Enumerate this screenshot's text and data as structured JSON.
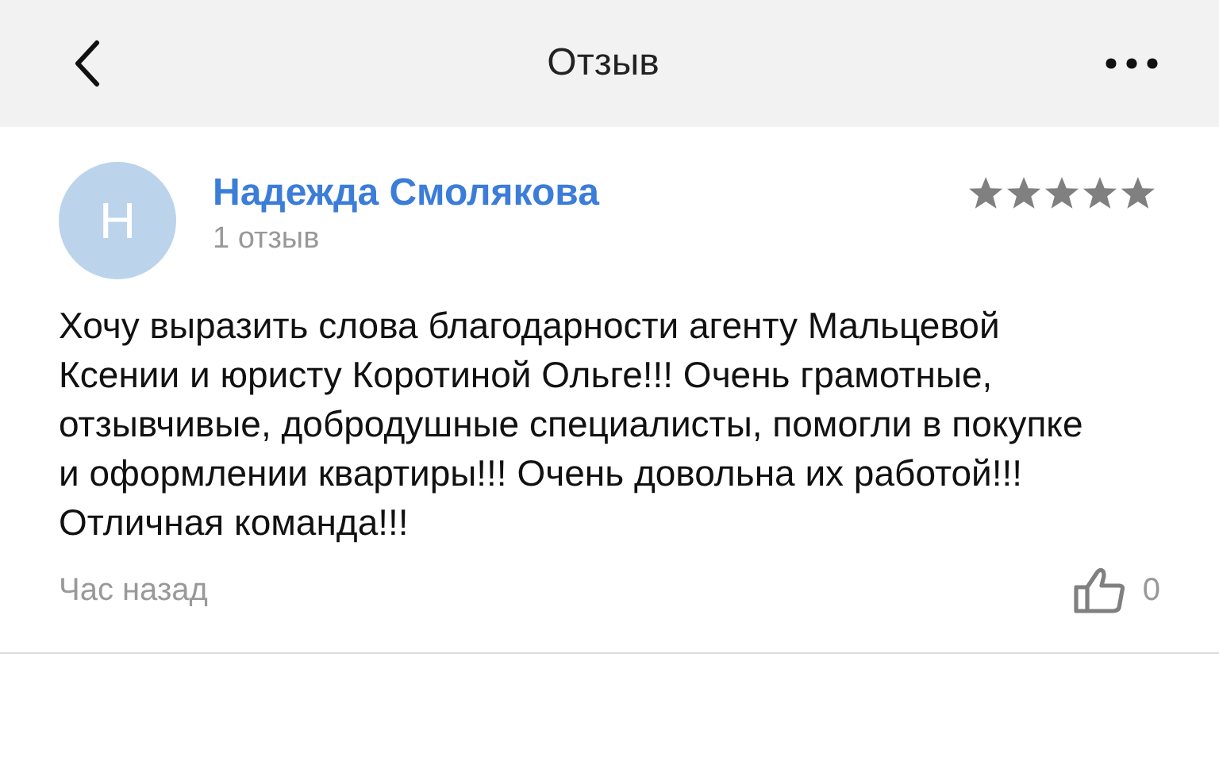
{
  "header": {
    "title": "Отзыв"
  },
  "review": {
    "avatar_letter": "Н",
    "author": "Надежда Смолякова",
    "author_reviews": "1 отзыв",
    "stars": 5,
    "text": "Хочу выразить слова благодарности агенту Мальцевой Ксении и юристу Коротиной Ольге!!! Очень грамотные, отзывчивые, добродушные специалисты, помогли в покупке и оформлении квартиры!!! Очень довольна их работой!!! Отличная команда!!!",
    "time": "Час назад",
    "likes": "0"
  }
}
